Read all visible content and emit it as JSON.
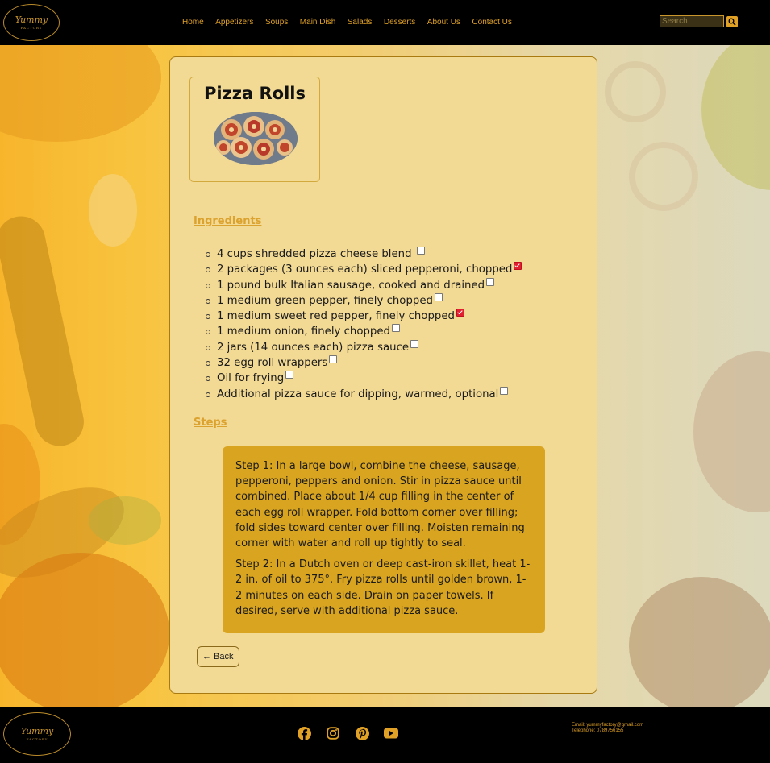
{
  "brand": {
    "logo_text": "Yummy",
    "logo_subtext": "FACTORY"
  },
  "nav": {
    "items": [
      "Home",
      "Appetizers",
      "Soups",
      "Main Dish",
      "Salads",
      "Desserts",
      "About Us",
      "Contact Us"
    ]
  },
  "search": {
    "placeholder": "Search",
    "icon": "search-icon"
  },
  "recipe": {
    "title": "Pizza Rolls",
    "ingredients_heading": "Ingredients",
    "ingredients": [
      {
        "text": "4 cups shredded pizza cheese blend ",
        "checked": false
      },
      {
        "text": "2 packages (3 ounces each) sliced pepperoni, chopped",
        "checked": true
      },
      {
        "text": "1 pound bulk Italian sausage, cooked and drained",
        "checked": false
      },
      {
        "text": "1 medium green pepper, finely chopped",
        "checked": false
      },
      {
        "text": "1 medium sweet red pepper, finely chopped",
        "checked": true
      },
      {
        "text": "1 medium onion, finely chopped",
        "checked": false
      },
      {
        "text": "2 jars (14 ounces each) pizza sauce",
        "checked": false
      },
      {
        "text": "32 egg roll wrappers",
        "checked": false
      },
      {
        "text": "Oil for frying",
        "checked": false
      },
      {
        "text": "Additional pizza sauce for dipping, warmed, optional",
        "checked": false
      }
    ],
    "steps_heading": "Steps",
    "steps": [
      "Step 1: In a large bowl, combine the cheese, sausage, pepperoni, peppers and onion. Stir in pizza sauce until combined. Place about 1/4 cup filling in the center of each egg roll wrapper. Fold bottom corner over filling; fold sides toward center over filling. Moisten remaining corner with water and roll up tightly to seal.",
      "Step 2: In a Dutch oven or deep cast-iron skillet, heat 1-2 in. of oil to 375°. Fry pizza rolls until golden brown, 1-2 minutes on each side. Drain on paper towels. If desired, serve with additional pizza sauce."
    ],
    "back_label": "← Back"
  },
  "footer": {
    "socials": [
      "facebook-icon",
      "instagram-icon",
      "pinterest-icon",
      "youtube-icon"
    ],
    "email": "Email: yummyfactory@gmail.com",
    "telephone": "Telephone: 0789756155"
  },
  "colors": {
    "accent": "#e0a126",
    "card_bg": "#f2d994",
    "steps_bg": "#d9a521",
    "checked": "#e02030"
  }
}
